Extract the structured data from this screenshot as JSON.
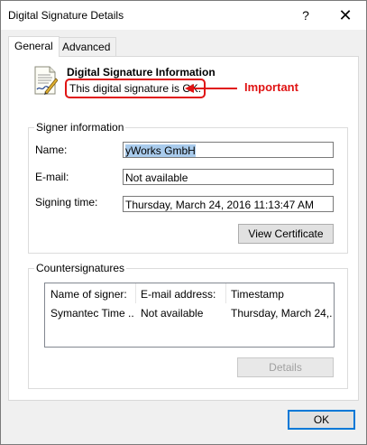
{
  "window": {
    "title": "Digital Signature Details",
    "help_glyph": "?",
    "close_glyph": "✕"
  },
  "tabs": [
    {
      "label": "General",
      "active": true
    },
    {
      "label": "Advanced",
      "active": false
    }
  ],
  "signature": {
    "heading": "Digital Signature Information",
    "status": "This digital signature is OK.",
    "annotation": "Important"
  },
  "signer": {
    "group_title": "Signer information",
    "name_label": "Name:",
    "name_value": "yWorks GmbH",
    "email_label": "E-mail:",
    "email_value": "Not available",
    "time_label": "Signing time:",
    "time_value": "Thursday, March 24, 2016 11:13:47 AM",
    "view_cert_button": "View Certificate"
  },
  "countersignatures": {
    "group_title": "Countersignatures",
    "columns": [
      "Name of signer:",
      "E-mail address:",
      "Timestamp"
    ],
    "rows": [
      [
        "Symantec Time ...",
        "Not available",
        "Thursday, March 24,..."
      ]
    ],
    "details_button": "Details"
  },
  "footer": {
    "ok_button": "OK"
  },
  "colors": {
    "annotation_red": "#e01414",
    "selection": "#a9cbec",
    "focus_blue": "#0078d7"
  }
}
